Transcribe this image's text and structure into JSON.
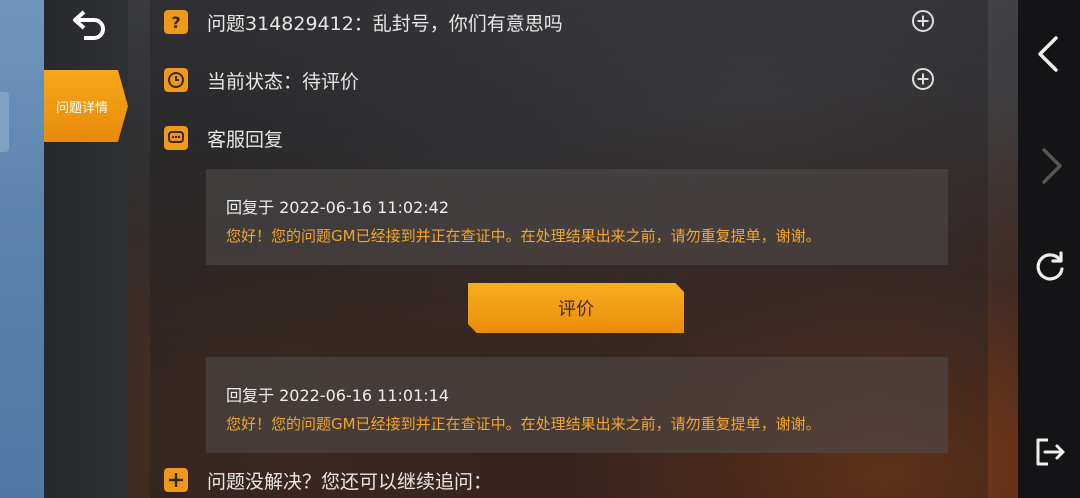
{
  "sidebar": {
    "active_tab": "问题详情"
  },
  "detail": {
    "question": "问题314829412：乱封号，你们有意思吗",
    "status": "当前状态：待评价",
    "support_reply_heading": "客服回复",
    "replies": [
      {
        "time": "回复于 2022-06-16 11:02:42",
        "body": "您好！您的问题GM已经接到并正在查证中。在处理结果出来之前，请勿重复提单，谢谢。"
      },
      {
        "time": "回复于 2022-06-16 11:01:14",
        "body": "您好！您的问题GM已经接到并正在查证中。在处理结果出来之前，请勿重复提单，谢谢。"
      }
    ],
    "rate_button": "评价",
    "followup": "问题没解决？您还可以继续追问：",
    "question_icon_glyph": "?"
  },
  "colors": {
    "accent": "#f0981a",
    "reply_text": "#f2a52e"
  },
  "icons": [
    "undo-icon",
    "question-icon",
    "clock-icon",
    "chat-icon",
    "plus-icon",
    "expand-icon",
    "back-arrow-icon",
    "forward-arrow-icon",
    "refresh-icon",
    "exit-icon"
  ]
}
